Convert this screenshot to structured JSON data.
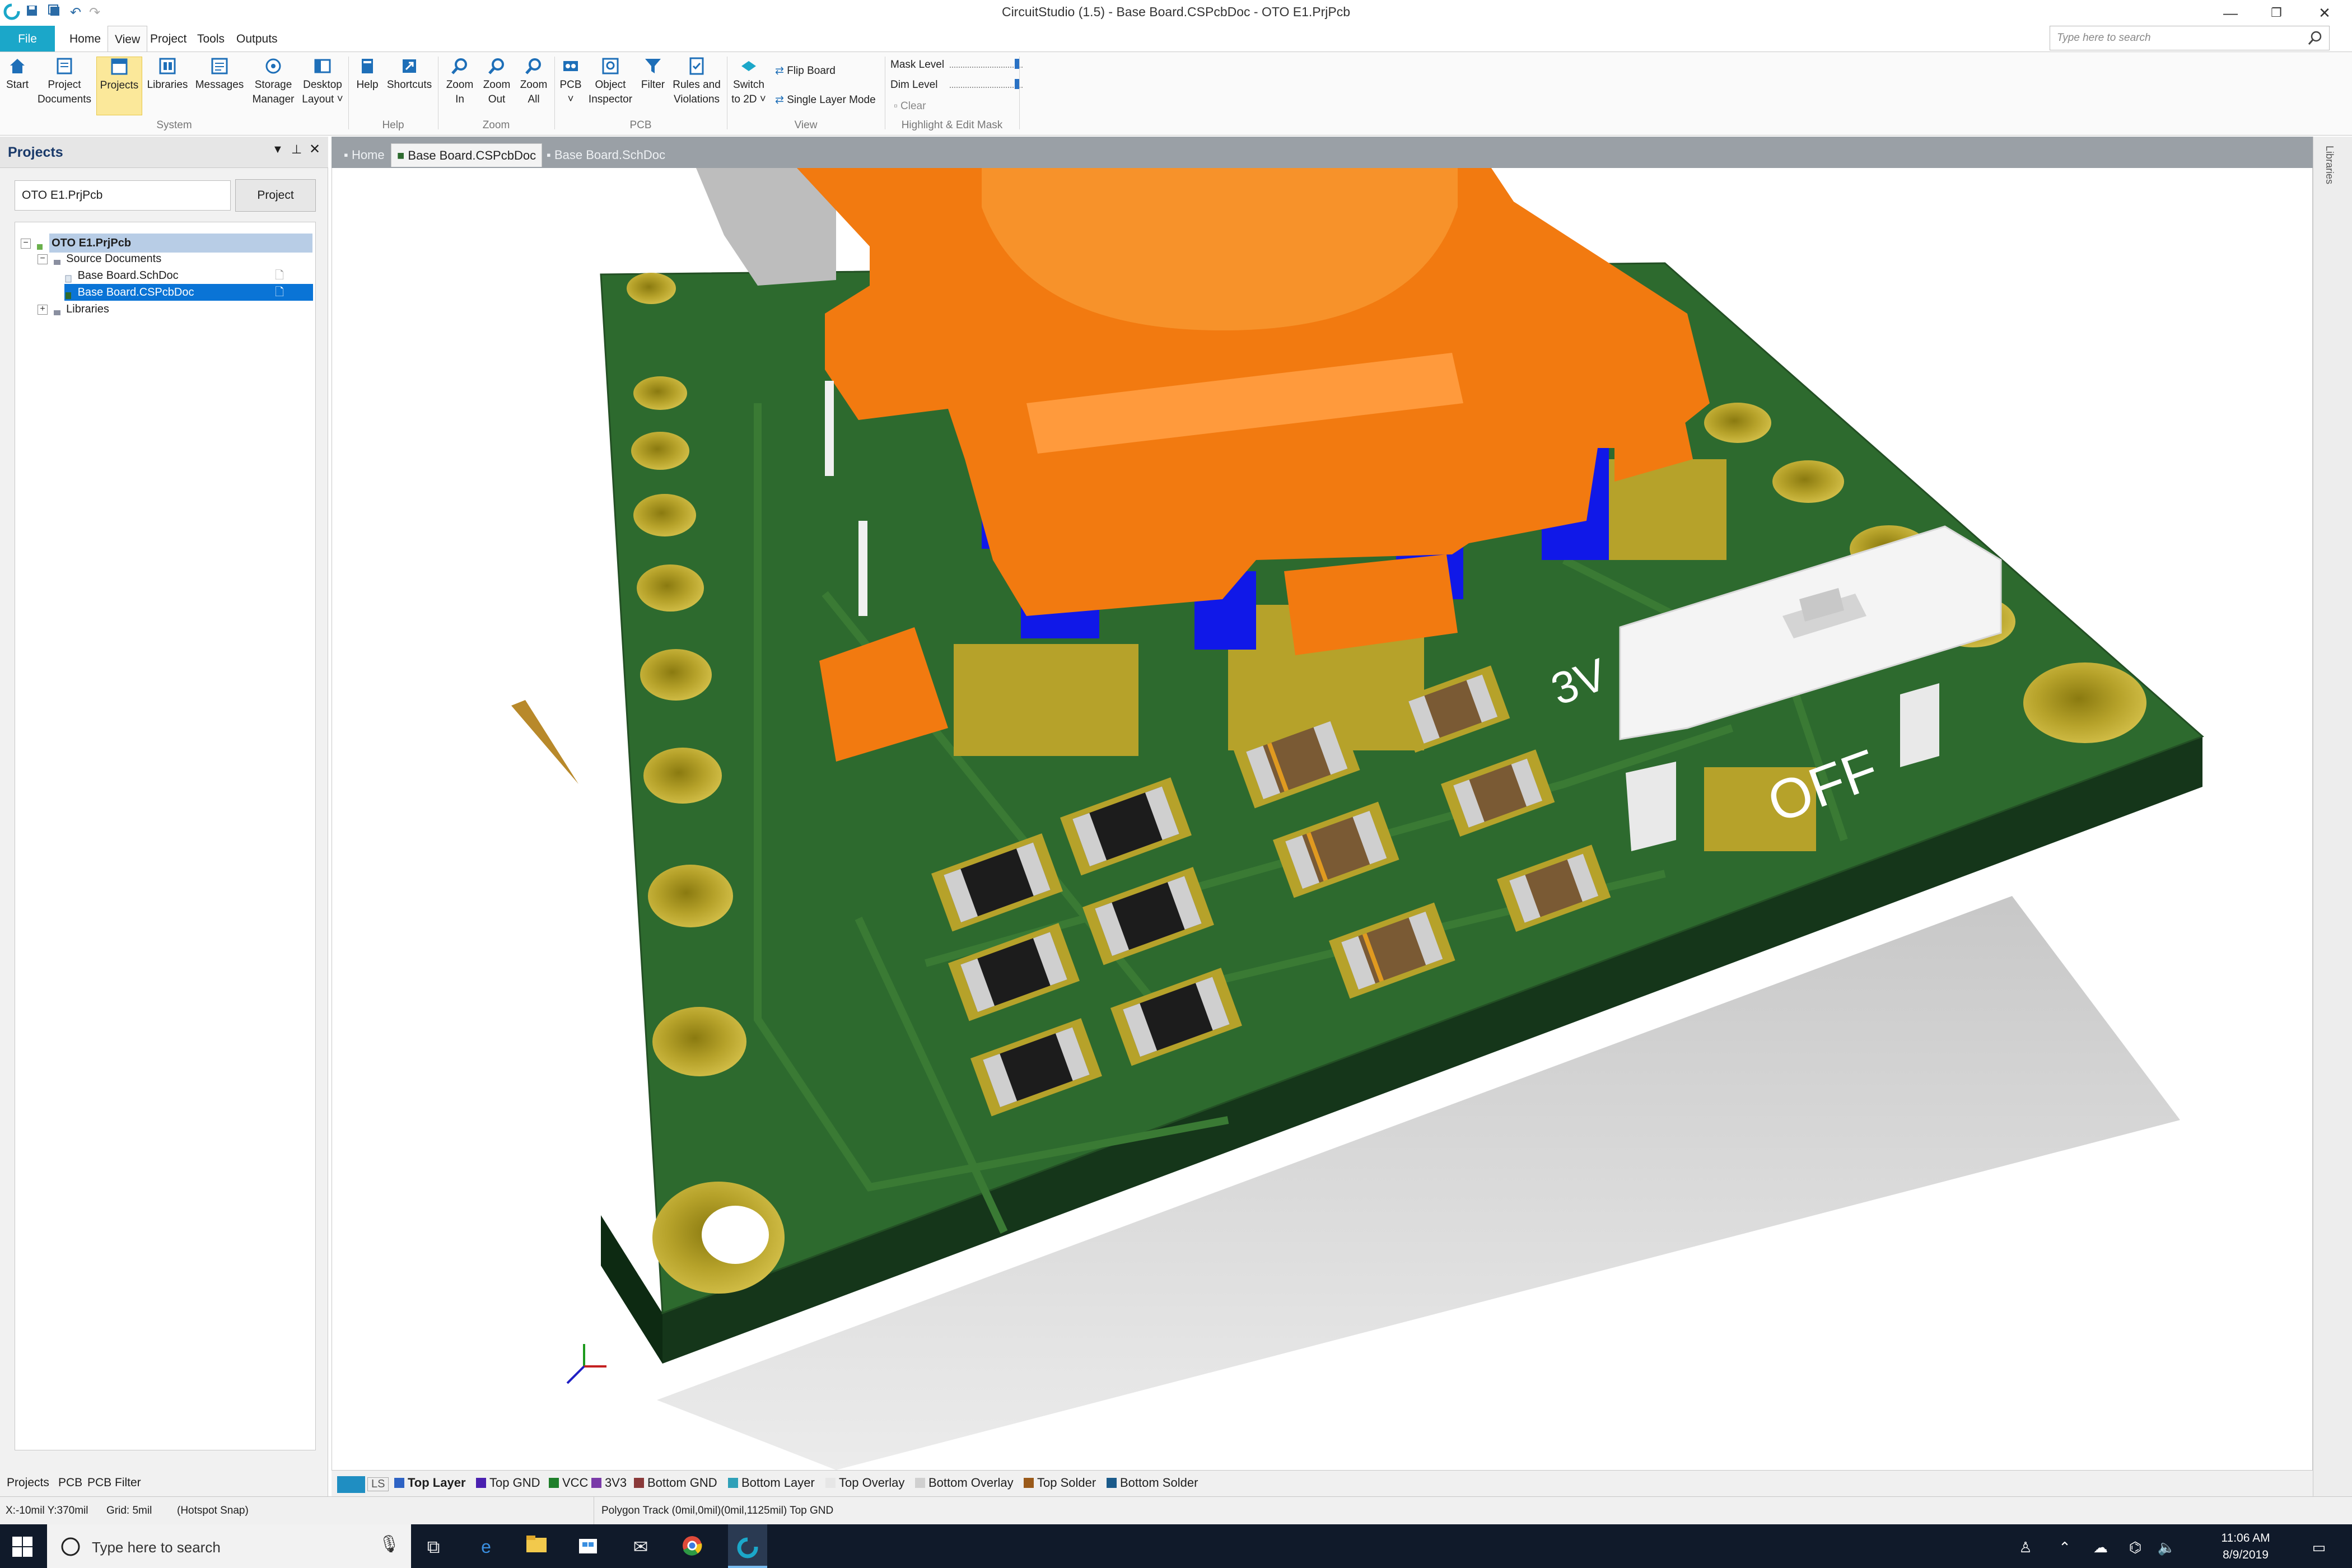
{
  "window": {
    "title": "CircuitStudio (1.5) - Base Board.CSPcbDoc - OTO E1.PrjPcb",
    "minimize": "—",
    "restore": "❐",
    "close": "✕"
  },
  "quick_access": {
    "undo": "↶",
    "redo": "↷"
  },
  "menu": {
    "file": "File",
    "tabs": [
      "Home",
      "View",
      "Project",
      "Tools",
      "Outputs"
    ],
    "active": "View",
    "search_placeholder": "Type here to search"
  },
  "ribbon": {
    "buttons": [
      {
        "id": "start",
        "label1": "Start",
        "label2": "",
        "icon": "home-icon"
      },
      {
        "id": "project-documents",
        "label1": "Project",
        "label2": "Documents",
        "icon": "documents-icon"
      },
      {
        "id": "projects",
        "label1": "Projects",
        "label2": "",
        "icon": "projects-icon"
      },
      {
        "id": "libraries",
        "label1": "Libraries",
        "label2": "",
        "icon": "libraries-icon"
      },
      {
        "id": "messages",
        "label1": "Messages",
        "label2": "",
        "icon": "messages-icon"
      },
      {
        "id": "storage-manager",
        "label1": "Storage",
        "label2": "Manager",
        "icon": "storage-icon"
      },
      {
        "id": "desktop-layout",
        "label1": "Desktop",
        "label2": "Layout ˅",
        "icon": "layout-icon"
      },
      {
        "id": "help",
        "label1": "Help",
        "label2": "",
        "icon": "help-icon"
      },
      {
        "id": "shortcuts",
        "label1": "Shortcuts",
        "label2": "",
        "icon": "shortcuts-icon"
      },
      {
        "id": "zoom-in",
        "label1": "Zoom",
        "label2": "In",
        "icon": "zoom-in-icon"
      },
      {
        "id": "zoom-out",
        "label1": "Zoom",
        "label2": "Out",
        "icon": "zoom-out-icon"
      },
      {
        "id": "zoom-all",
        "label1": "Zoom",
        "label2": "All",
        "icon": "zoom-all-icon"
      },
      {
        "id": "pcb",
        "label1": "PCB",
        "label2": "˅",
        "icon": "pcb-icon"
      },
      {
        "id": "object-inspector",
        "label1": "Object",
        "label2": "Inspector",
        "icon": "inspector-icon"
      },
      {
        "id": "filter",
        "label1": "Filter",
        "label2": "",
        "icon": "filter-icon"
      },
      {
        "id": "rules-violations",
        "label1": "Rules and",
        "label2": "Violations",
        "icon": "rules-icon"
      },
      {
        "id": "switch-2d",
        "label1": "Switch",
        "label2": "to 2D ˅",
        "icon": "switch-2d-icon"
      }
    ],
    "flip_board": "Flip Board",
    "single_layer_mode": "Single Layer Mode",
    "mask_level": "Mask Level",
    "dim_level": "Dim Level",
    "clear": "Clear",
    "groups": {
      "system": "System",
      "help": "Help",
      "zoom": "Zoom",
      "pcb": "PCB",
      "view": "View",
      "highlight": "Highlight & Edit Mask"
    }
  },
  "projects_panel": {
    "title": "Projects",
    "project_field": "OTO E1.PrjPcb",
    "project_button": "Project",
    "tree": {
      "root": "OTO E1.PrjPcb",
      "source_documents": "Source Documents",
      "sch": "Base Board.SchDoc",
      "pcb": "Base Board.CSPcbDoc",
      "libraries": "Libraries"
    },
    "bottom_tabs": [
      "Projects",
      "PCB",
      "PCB Filter"
    ]
  },
  "doc_tabs": {
    "home": "Home",
    "pcb": "Base Board.CSPcbDoc",
    "sch": "Base Board.SchDoc"
  },
  "right_strip": {
    "label": "Libraries"
  },
  "board": {
    "silk_off": "OFF",
    "silk_3v": "3V"
  },
  "layers": {
    "ls": "LS",
    "items": [
      {
        "name": "Top Layer",
        "color": "#2e63c4"
      },
      {
        "name": "Top GND",
        "color": "#4a20b0"
      },
      {
        "name": "VCC",
        "color": "#1e7f2a"
      },
      {
        "name": "3V3",
        "color": "#7a3aa8"
      },
      {
        "name": "Bottom GND",
        "color": "#8a3a3a"
      },
      {
        "name": "Bottom Layer",
        "color": "#2fa0b8"
      },
      {
        "name": "Top Overlay",
        "color": "#e6e6e6"
      },
      {
        "name": "Bottom Overlay",
        "color": "#d0d0d0"
      },
      {
        "name": "Top Solder",
        "color": "#9a5a1a"
      },
      {
        "name": "Bottom Solder",
        "color": "#1a5a8a"
      }
    ]
  },
  "status": {
    "coords": "X:-10mil Y:370mil",
    "grid": "Grid: 5mil",
    "snap": "(Hotspot Snap)",
    "selection": "Polygon Track (0mil,0mil)(0mil,1125mil)  Top GND"
  },
  "taskbar": {
    "search": "Type here to search",
    "time": "11:06 AM",
    "date": "8/9/2019"
  },
  "colors": {
    "accent": "#1ba7c9",
    "pcb_green": "#2d6a2e",
    "pad_gold": "#b8a12a",
    "switch_orange": "#f27a10",
    "pin_blue": "#1018e8"
  }
}
